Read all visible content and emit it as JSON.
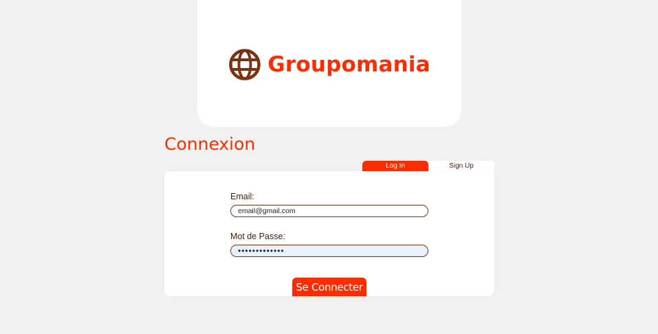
{
  "logo": {
    "brand_name": "Groupomania",
    "icon": "globe-icon",
    "icon_color": "#7a3212",
    "brand_color": "#fd2d01"
  },
  "page": {
    "title": "Connexion"
  },
  "tabs": {
    "login": "Log In",
    "signup": "Sign Up",
    "active": "login"
  },
  "form": {
    "email_label": "Email:",
    "email_value": "email@gmail.com",
    "password_label": "Mot de Passe:",
    "password_value": "•••••••••••••",
    "submit_label": "Se Connecter"
  },
  "colors": {
    "accent": "#fd2d01",
    "text_dark": "#4e1a0a",
    "background": "#f1f1f1",
    "autofill": "#e8f0fe"
  }
}
